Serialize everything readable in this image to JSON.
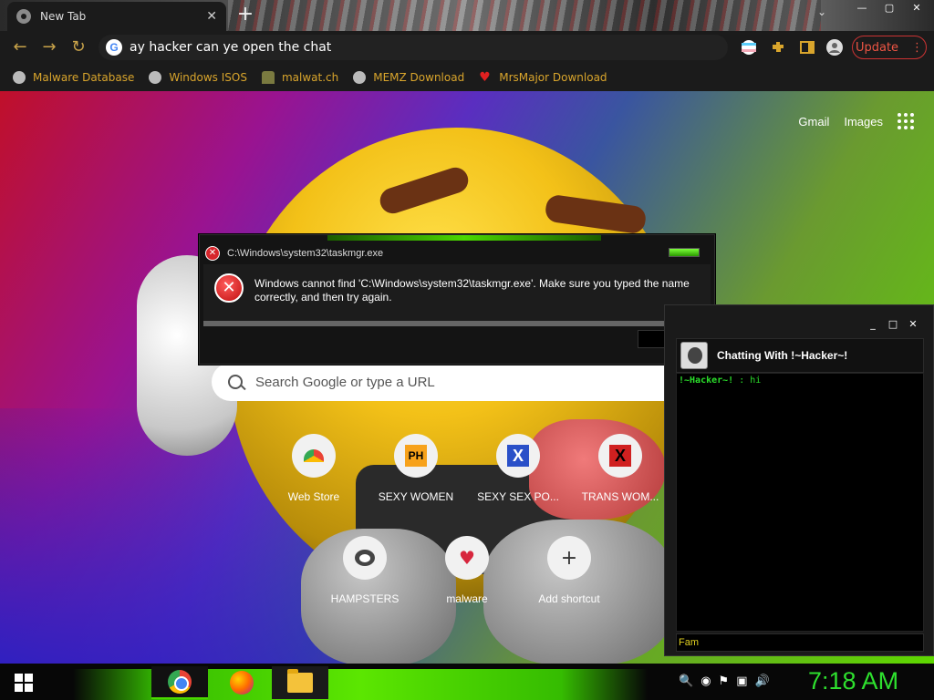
{
  "browser": {
    "tab_title": "New Tab",
    "tab_close": "✕",
    "new_tab": "+",
    "tab_dropdown": "⌄",
    "window_controls": {
      "minimize": "—",
      "maximize": "▢",
      "close": "✕"
    },
    "back": "←",
    "forward": "→",
    "reload": "↻",
    "url": "ay hacker can ye open the chat",
    "update_label": "Update",
    "menu_dots": "⋮",
    "accent": "#d9a52c"
  },
  "bookmarks": [
    {
      "label": "Malware Database",
      "icon": "globe-icon"
    },
    {
      "label": "Windows ISOS",
      "icon": "globe-icon"
    },
    {
      "label": "malwat.ch",
      "icon": "person-icon"
    },
    {
      "label": "MEMZ Download",
      "icon": "globe-icon"
    },
    {
      "label": "MrsMajor Download",
      "icon": "heart-icon"
    }
  ],
  "google": {
    "gmail": "Gmail",
    "images": "Images",
    "search_placeholder": "Search Google or type a URL"
  },
  "shortcuts": [
    {
      "label": "Web Store",
      "icon": "webstore-icon"
    },
    {
      "label": "SEXY WOMEN",
      "icon_text": "PH"
    },
    {
      "label": "SEXY SEX PO...",
      "icon_text": "X"
    },
    {
      "label": "TRANS WOM...",
      "icon_text": "X"
    },
    {
      "label": "HAMPSTERS",
      "icon": "hamster-icon"
    },
    {
      "label": "malware",
      "icon": "heart-icon"
    },
    {
      "label": "Add shortcut",
      "icon_text": "+"
    }
  ],
  "error_dialog": {
    "title": "C:\\Windows\\system32\\taskmgr.exe",
    "icon_glyph": "✕",
    "message": "Windows cannot find 'C:\\Windows\\system32\\taskmgr.exe'. Make sure you typed the name correctly, and then try again."
  },
  "chat": {
    "controls": {
      "minimize": "_",
      "maximize": "□",
      "close": "✕"
    },
    "title": "Chatting With !~Hacker~!",
    "messages": [
      {
        "sender": "!~Hacker~!",
        "sep": " : ",
        "text": "hi"
      }
    ],
    "input_value": "Fam"
  },
  "taskbar": {
    "clock": "7:18 AM",
    "accent": "#2ee02e"
  }
}
